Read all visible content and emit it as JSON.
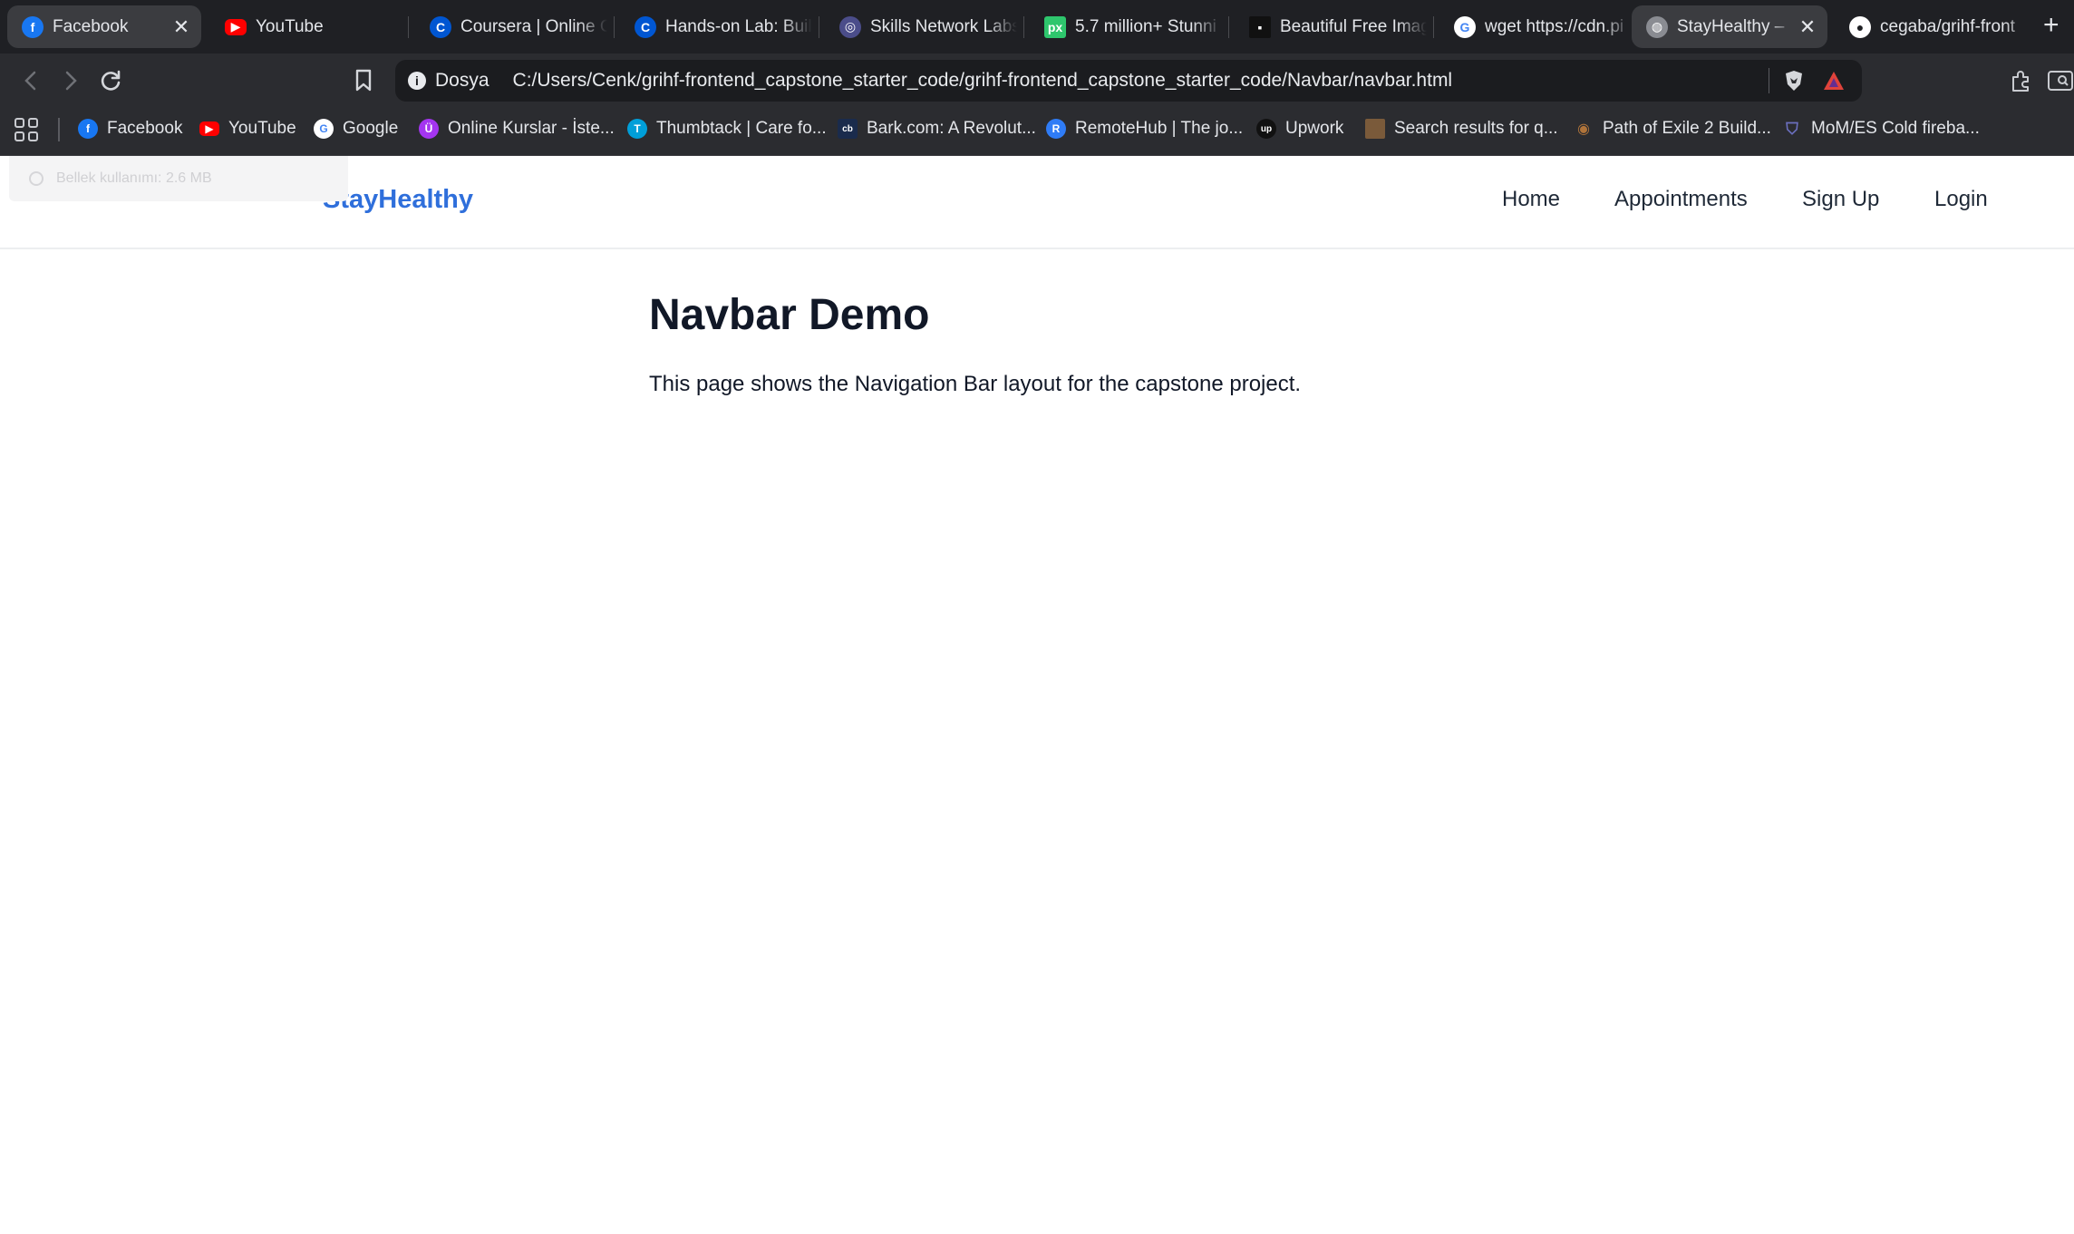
{
  "browser": {
    "tabs": [
      {
        "label": "Facebook",
        "icon": "facebook-icon",
        "color": "#1877f2",
        "active": false,
        "close": "✕"
      },
      {
        "label": "YouTube",
        "icon": "youtube-icon",
        "color": "#ff0000"
      },
      {
        "label": "Coursera | Online C",
        "icon": "coursera-icon",
        "color": "#0056d2"
      },
      {
        "label": "Hands-on Lab: Buil",
        "icon": "coursera-icon",
        "color": "#0056d2"
      },
      {
        "label": "Skills Network Labs",
        "icon": "skills-network-icon",
        "color": "#4b4d8a"
      },
      {
        "label": "5.7 million+ Stunni",
        "icon": "pixabay-icon",
        "color": "#2ec66d"
      },
      {
        "label": "Beautiful Free Imag",
        "icon": "unsplash-icon",
        "color": "#111111"
      },
      {
        "label": "wget https://cdn.pi",
        "icon": "google-icon",
        "color": "#4285f4"
      },
      {
        "label": "StayHealthy – ",
        "icon": "globe-icon",
        "color": "#8a8c92",
        "active": true,
        "close": "✕"
      },
      {
        "label": "cegaba/grihf-front",
        "icon": "github-icon",
        "color": "#ffffff"
      }
    ],
    "new_tab": "+",
    "address": {
      "protocol_label": "Dosya",
      "url": "C:/Users/Cenk/grihf-frontend_capstone_starter_code/grihf-frontend_capstone_starter_code/Navbar/navbar.html"
    },
    "bookmarks": [
      {
        "label": "Facebook",
        "icon": "facebook-icon",
        "color": "#1877f2"
      },
      {
        "label": "YouTube",
        "icon": "youtube-icon",
        "color": "#ff0000"
      },
      {
        "label": "Google",
        "icon": "google-icon",
        "color": "#4285f4"
      },
      {
        "label": "Online Kurslar - İste...",
        "icon": "udemy-icon",
        "color": "#a435f0"
      },
      {
        "label": "Thumbtack | Care fo...",
        "icon": "thumbtack-icon",
        "color": "#009fd9"
      },
      {
        "label": "Bark.com: A Revolut...",
        "icon": "bark-icon",
        "color": "#1a2b4c"
      },
      {
        "label": "RemoteHub | The jo...",
        "icon": "remotehub-icon",
        "color": "#2f7cf6"
      },
      {
        "label": "Upwork",
        "icon": "upwork-icon",
        "color": "#111111"
      },
      {
        "label": "Search results for q...",
        "icon": "search-results-icon",
        "color": "#7a5a3a"
      },
      {
        "label": "Path of Exile 2 Build...",
        "icon": "poe-icon",
        "color": "#b0743a"
      },
      {
        "label": "MoM/ES Cold fireba...",
        "icon": "shield-icon",
        "color": "#6b6fbf"
      }
    ],
    "memory_tooltip": "Bellek kullanımı: 2.6 MB"
  },
  "page": {
    "brand": "StayHealthy",
    "nav_links": [
      "Home",
      "Appointments",
      "Sign Up",
      "Login"
    ],
    "heading": "Navbar Demo",
    "description": "This page shows the Navigation Bar layout for the capstone project."
  },
  "colors": {
    "brand": "#2f6fdb",
    "tabbar_bg": "#1f2024",
    "toolbar_bg": "#2b2c30",
    "text_dark": "#111827"
  }
}
